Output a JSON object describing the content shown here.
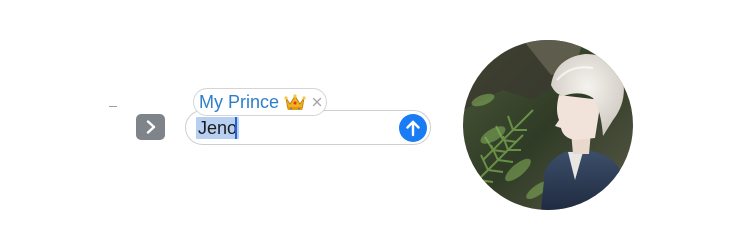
{
  "composer": {
    "suggestion_label": "My Prince",
    "suggestion_emoji": "crown-icon",
    "input_value": "Jeno"
  },
  "icons": {
    "expand": "chevron-right-icon",
    "send": "arrow-up-icon",
    "clear": "close-icon"
  },
  "colors": {
    "accent": "#1a7cf5",
    "suggestion_text": "#2f7ec9",
    "selection": "#b7cff0",
    "expand_button": "#7f848b"
  },
  "avatar": {
    "description": ""
  }
}
